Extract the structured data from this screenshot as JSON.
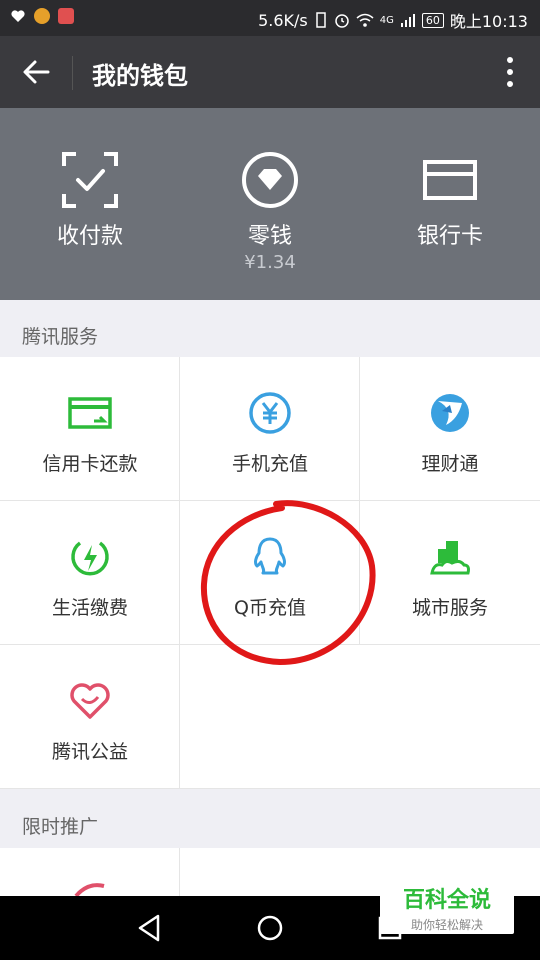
{
  "status_bar": {
    "speed": "5.6K/s",
    "network": "4G",
    "battery": "60",
    "time": "晚上10:13"
  },
  "app_bar": {
    "title": "我的钱包"
  },
  "wallet_header": {
    "items": [
      {
        "label": "收付款",
        "icon": "scan-pay-icon"
      },
      {
        "label": "零钱",
        "sub": "¥1.34",
        "icon": "diamond-coin-icon"
      },
      {
        "label": "银行卡",
        "icon": "bank-card-icon"
      }
    ]
  },
  "tencent_services": {
    "title": "腾讯服务",
    "items": [
      {
        "label": "信用卡还款",
        "icon": "credit-card-repay-icon"
      },
      {
        "label": "手机充值",
        "icon": "yuan-coin-icon"
      },
      {
        "label": "理财通",
        "icon": "wealth-icon"
      },
      {
        "label": "生活缴费",
        "icon": "utility-bolt-icon"
      },
      {
        "label": "Q币充值",
        "icon": "qq-penguin-icon"
      },
      {
        "label": "城市服务",
        "icon": "city-icon"
      },
      {
        "label": "腾讯公益",
        "icon": "charity-heart-icon"
      }
    ]
  },
  "promotions": {
    "title": "限时推广"
  },
  "watermark": {
    "title": "百科全说",
    "subtitle": "助你轻松解决"
  },
  "colors": {
    "status_bar": "#2b2b2e",
    "app_bar": "#3a3a3e",
    "header": "#6d7178",
    "green": "#2dbb3a",
    "blue": "#3aa0e0",
    "red_mark": "#e01818"
  }
}
